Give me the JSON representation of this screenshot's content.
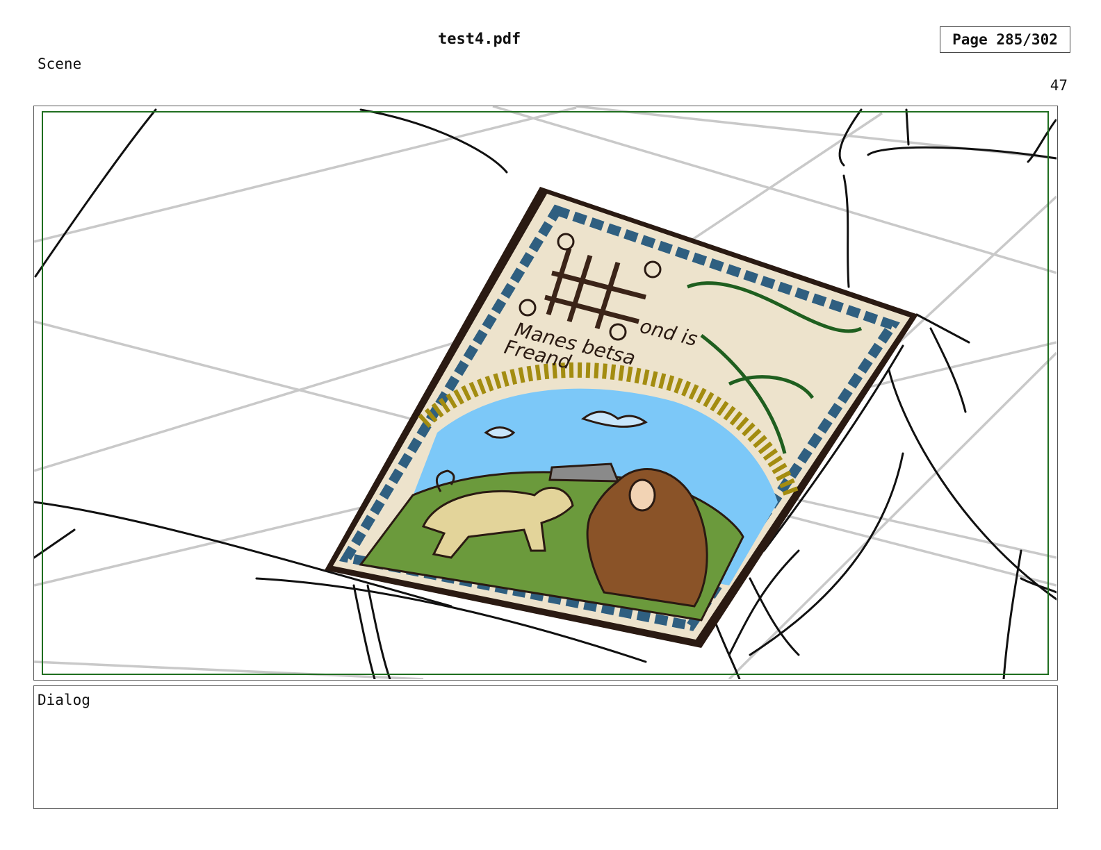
{
  "header": {
    "file_name": "test4.pdf",
    "page_indicator": "Page 285/302"
  },
  "scene": {
    "label": "Scene",
    "number": "47"
  },
  "panel": {
    "illustration": {
      "icon": "storyboard-sketch",
      "card_text_line1": "ond is",
      "card_text_line2": "Manes betsa",
      "card_text_line3": "Freand"
    }
  },
  "dialog": {
    "label": "Dialog",
    "text": ""
  },
  "colors": {
    "safe_area": "#1f6e1f",
    "sky": "#7cc8f8",
    "grass": "#6b9a3c",
    "parchment": "#ede3cc",
    "braid": "#2f5f80",
    "sun": "#a38c10",
    "robe": "#8a5328"
  }
}
